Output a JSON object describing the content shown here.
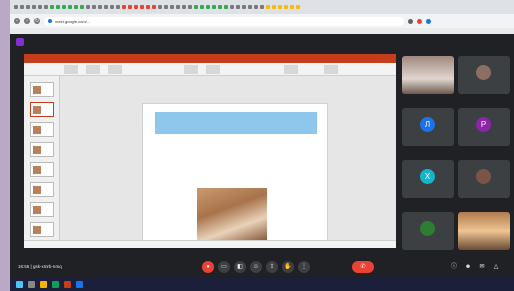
{
  "browser": {
    "url": "meet.google.com/...",
    "tab_colors": [
      "#4285f4",
      "#34a853",
      "#fbbc05",
      "#ea4335",
      "#4285f4",
      "#34a853",
      "#ea4335",
      "#fbbc05"
    ]
  },
  "meet": {
    "presenter_label": "",
    "meeting_code": "gsk-xmrb-nmq",
    "time": "16:55"
  },
  "slide": {
    "heading": "",
    "body": ""
  },
  "participants": [
    {
      "name": "",
      "avatar_letter": "",
      "color": "#6d4c41",
      "video": true
    },
    {
      "name": "",
      "avatar_letter": "",
      "color": "#8d6e63",
      "video": false
    },
    {
      "name": "",
      "avatar_letter": "Л",
      "color": "#1a73e8",
      "video": false
    },
    {
      "name": "",
      "avatar_letter": "Р",
      "color": "#8e24aa",
      "video": false
    },
    {
      "name": "",
      "avatar_letter": "Х",
      "color": "#12b5cb",
      "video": false
    },
    {
      "name": "",
      "avatar_letter": "",
      "color": "#795548",
      "video": false
    },
    {
      "name": "",
      "avatar_letter": "",
      "color": "#2e7d32",
      "video": false
    },
    {
      "name": "",
      "avatar_letter": "",
      "color": "#5d4037",
      "video": true
    }
  ],
  "controls": {
    "mic_icon": "mic-icon",
    "cam_icon": "camera-icon",
    "captions_icon": "captions-icon",
    "present_icon": "present-icon",
    "reaction_icon": "emoji-icon",
    "hand_icon": "raise-hand-icon",
    "more_icon": "more-icon",
    "end_icon": "end-call-icon",
    "end_glyph": "✆"
  },
  "colors": {
    "accent": "#ea4335",
    "ppt": "#c43e1c",
    "slide_heading": "#8ec7ec"
  }
}
